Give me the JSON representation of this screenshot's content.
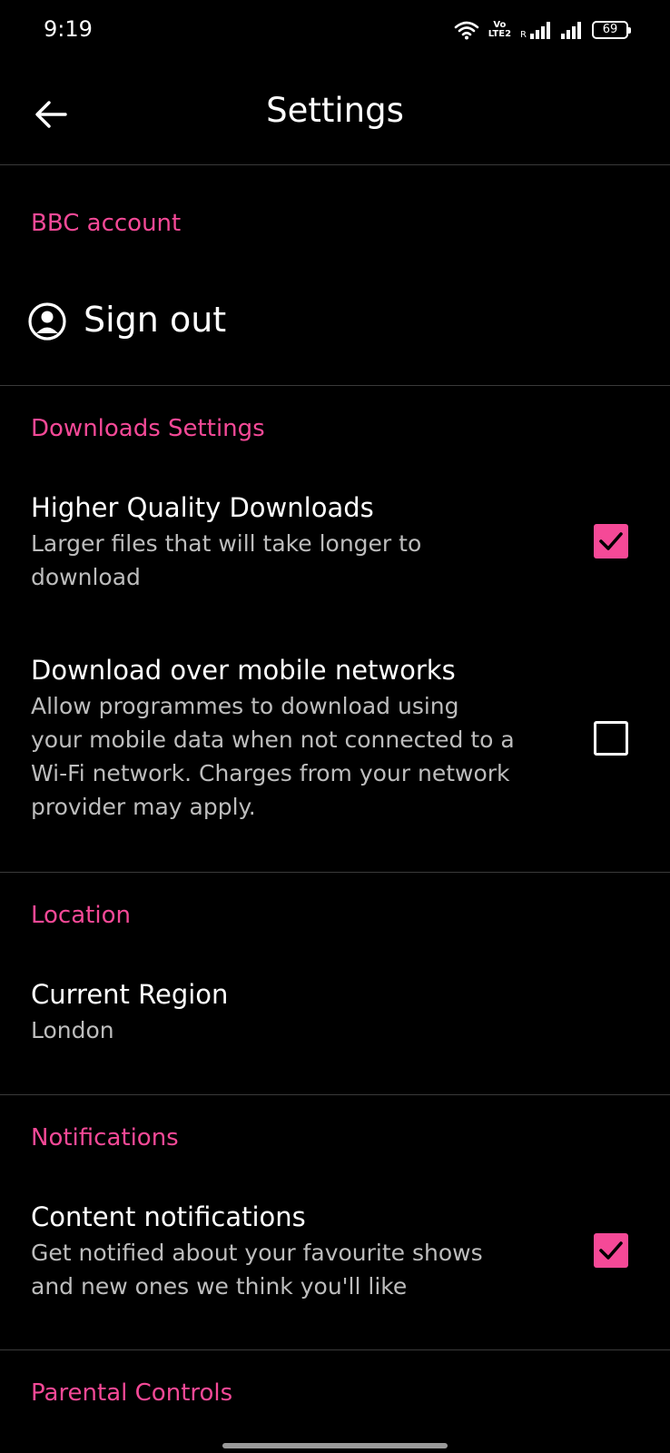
{
  "status_bar": {
    "time": "9:19",
    "volte_top": "Vo",
    "volte_bottom": "LTE2",
    "roaming": "R",
    "battery": "69"
  },
  "app_bar": {
    "title": "Settings",
    "back_icon": "arrow-left-icon"
  },
  "sections": {
    "account": {
      "header": "BBC account",
      "sign_out_label": "Sign out",
      "sign_out_icon": "account-circle-icon"
    },
    "downloads": {
      "header": "Downloads Settings",
      "hq": {
        "title": "Higher Quality Downloads",
        "line1": "Larger files that will take longer to",
        "line2": "download",
        "checked": true
      },
      "mobile": {
        "title": "Download over mobile networks",
        "line1": "Allow programmes to download using",
        "line2": "your mobile data when not connected to a",
        "line3": "Wi-Fi network. Charges from your network",
        "line4": "provider may apply.",
        "checked": false
      }
    },
    "location": {
      "header": "Location",
      "region_title": "Current Region",
      "region_value": "London"
    },
    "notifications": {
      "header": "Notifications",
      "content": {
        "title": "Content notifications",
        "line1": "Get notified about your favourite shows",
        "line2": "and new ones we think you'll like",
        "checked": true
      }
    },
    "parental": {
      "header": "Parental Controls"
    }
  },
  "colors": {
    "accent": "#f54997",
    "background": "#000000",
    "subtitle": "#bdbdbd",
    "divider": "#3a3a3a"
  }
}
